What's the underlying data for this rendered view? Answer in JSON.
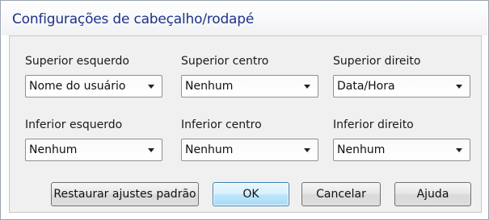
{
  "dialog": {
    "title": "Configurações de cabeçalho/rodapé"
  },
  "fields": [
    {
      "label": "Superior esquerdo",
      "value": "Nome do usuário"
    },
    {
      "label": "Superior centro",
      "value": "Nenhum"
    },
    {
      "label": "Superior direito",
      "value": "Data/Hora"
    },
    {
      "label": "Inferior esquerdo",
      "value": "Nenhum"
    },
    {
      "label": "Inferior centro",
      "value": "Nenhum"
    },
    {
      "label": "Inferior direito",
      "value": "Nenhum"
    }
  ],
  "buttons": {
    "restore": "Restaurar ajustes padrão",
    "ok": "OK",
    "cancel": "Cancelar",
    "help": "Ajuda"
  },
  "icons": {
    "dropdown": "chevron-down-icon"
  },
  "colors": {
    "title_text": "#1e3287",
    "panel_bg": "#f0f0f0",
    "primary_button_border": "#3c7fb1"
  }
}
